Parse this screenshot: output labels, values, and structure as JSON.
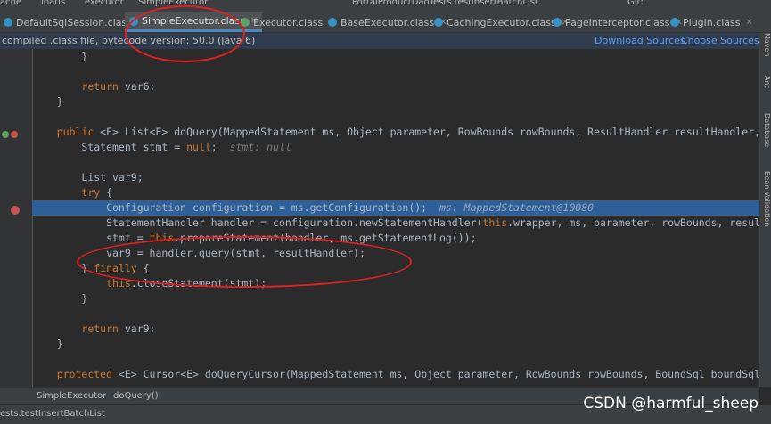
{
  "breadcrumb_top": {
    "items": [
      "ache",
      "ibatis",
      "executor",
      "SimpleExecutor"
    ],
    "run_config": "PortalProductDaoTests.testInsertBatchList",
    "git_label": "Git:"
  },
  "tabs": [
    {
      "label": "DefaultSqlSession.class",
      "active": false
    },
    {
      "label": "SimpleExecutor.class",
      "active": true
    },
    {
      "label": "Executor.class",
      "active": false
    },
    {
      "label": "BaseExecutor.class",
      "active": false
    },
    {
      "label": "CachingExecutor.class",
      "active": false
    },
    {
      "label": "PageInterceptor.class",
      "active": false
    },
    {
      "label": "Plugin.class",
      "active": false
    }
  ],
  "banner": {
    "message": "compiled .class file, bytecode version: 50.0 (Java 6)",
    "download_sources": "Download Sources",
    "choose_sources": "Choose Sources..."
  },
  "right_tools": [
    "Maven",
    "Ant",
    "Database",
    "Bean Validation"
  ],
  "code_lines": [
    {
      "text": "        }"
    },
    {
      "text": ""
    },
    {
      "text": "        return var6;"
    },
    {
      "text": "    }"
    },
    {
      "text": ""
    },
    {
      "text": "    public <E> List<E> doQuery(MappedStatement ms, Object parameter, RowBounds rowBounds, ResultHandler resultHandler, Bo"
    },
    {
      "text": "        Statement stmt = null;",
      "hint": "  stmt: null"
    },
    {
      "text": ""
    },
    {
      "text": "        List var9;"
    },
    {
      "text": "        try {"
    },
    {
      "text": "            Configuration configuration = ms.getConfiguration();",
      "hint": "  ms: MappedStatement@10080",
      "highlight": true
    },
    {
      "text": "            StatementHandler handler = configuration.newStatementHandler(this.wrapper, ms, parameter, rowBounds, resultHa"
    },
    {
      "text": "            stmt = this.prepareStatement(handler, ms.getStatementLog());"
    },
    {
      "text": "            var9 = handler.query(stmt, resultHandler);"
    },
    {
      "text": "        } finally {"
    },
    {
      "text": "            this.closeStatement(stmt);"
    },
    {
      "text": "        }"
    },
    {
      "text": ""
    },
    {
      "text": "        return var9;"
    },
    {
      "text": "    }"
    },
    {
      "text": ""
    },
    {
      "text": "    protected <E> Cursor<E> doQueryCursor(MappedStatement ms, Object parameter, RowBounds rowBounds, BoundSql boundSql) "
    }
  ],
  "breadcrumbs": [
    "SimpleExecutor",
    "doQuery()"
  ],
  "status": "ests.testInsertBatchList",
  "watermark": "CSDN @harmful_sheep",
  "colors": {
    "keyword": "#cc7832",
    "text": "#a9b7c6",
    "highlight": "#2d6099",
    "annotation": "#e02020"
  }
}
